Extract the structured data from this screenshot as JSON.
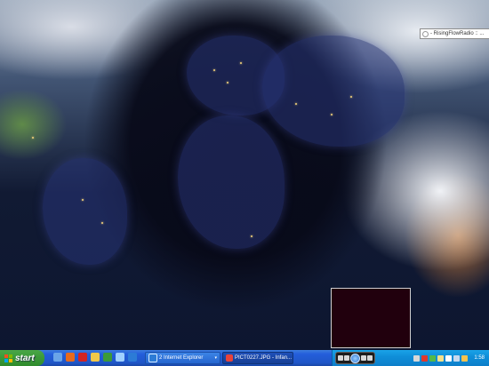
{
  "desktop": {
    "notification_chip": "- RisingFlowRadio :: ..."
  },
  "taskbar": {
    "start_label": "start",
    "tasks": [
      {
        "label": "2 Internet Explorer",
        "icon": "internet-explorer-icon",
        "has_dropdown": true
      },
      {
        "label": "PICT0227.JPG - Infan...",
        "icon": "image-viewer-icon",
        "has_dropdown": false
      }
    ],
    "clock": "1:58"
  },
  "colors": {
    "taskbar_blue": "#245edb",
    "start_green": "#3c9a39",
    "tray_blue": "#0f8fd9"
  }
}
